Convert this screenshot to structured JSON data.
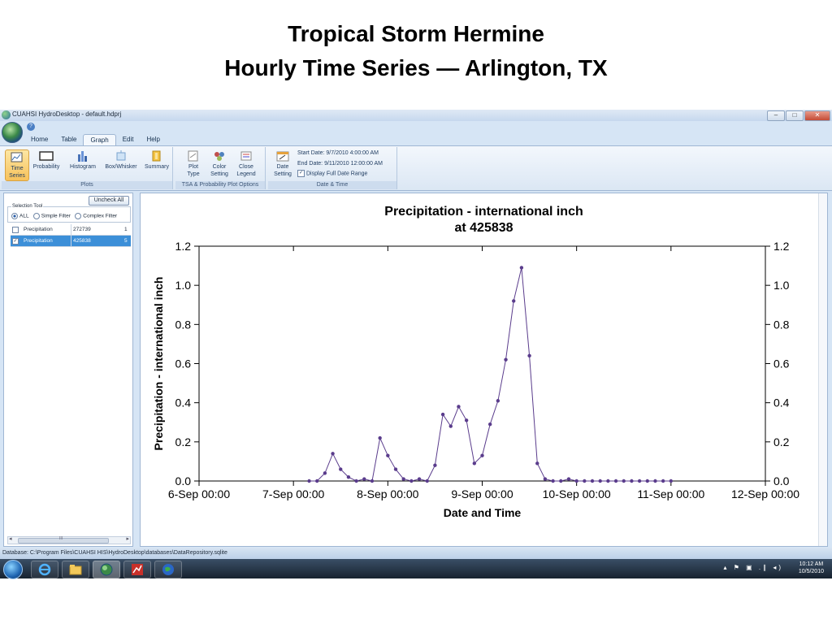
{
  "slide": {
    "title_line1": "Tropical Storm Hermine",
    "title_line2": "Hourly Time Series — Arlington, TX"
  },
  "window": {
    "title": "CUAHSI HydroDesktop - default.hdprj",
    "controls": {
      "minimize": "–",
      "maximize": "□",
      "close": "✕"
    }
  },
  "tabs": [
    "Home",
    "Table",
    "Graph",
    "Edit",
    "Help"
  ],
  "active_tab": "Graph",
  "ribbon": {
    "plots_group": {
      "label": "Plots",
      "buttons": [
        {
          "label_line1": "Time",
          "label_line2": "Series",
          "icon": "time-series-icon",
          "selected": true
        },
        {
          "label_line1": "Probability",
          "label_line2": "",
          "icon": "probability-icon"
        },
        {
          "label_line1": "Histogram",
          "label_line2": "",
          "icon": "histogram-icon"
        },
        {
          "label_line1": "Box/Whisker",
          "label_line2": "",
          "icon": "box-whisker-icon"
        },
        {
          "label_line1": "Summary",
          "label_line2": "",
          "icon": "summary-icon"
        }
      ]
    },
    "plot_options_group": {
      "label": "TSA & Probability Plot Options",
      "buttons": [
        {
          "label_line1": "Plot",
          "label_line2": "Type",
          "icon": "plot-type-icon"
        },
        {
          "label_line1": "Color",
          "label_line2": "Setting",
          "icon": "color-setting-icon"
        },
        {
          "label_line1": "Close",
          "label_line2": "Legend",
          "icon": "close-legend-icon"
        }
      ]
    },
    "date_group": {
      "label": "Date & Time",
      "button": {
        "label_line1": "Date",
        "label_line2": "Setting",
        "icon": "date-setting-icon"
      },
      "start_date": "Start Date: 9/7/2010 4:00:00 AM",
      "end_date": "End Date:  9/11/2010 12:00:00 AM",
      "full_range_label": "Display Full Date Range",
      "full_range_checked": "✓"
    }
  },
  "left_panel": {
    "uncheck_all": "Uncheck All",
    "selection_tool_label": "Selection Tool",
    "radio_all": "ALL",
    "radio_simple": "Simple Filter",
    "radio_complex": "Complex Filter",
    "rows": [
      {
        "check": "",
        "variable": "Precipitation",
        "site": "272739",
        "count": "1"
      },
      {
        "check": "✓",
        "variable": "Precipitation",
        "site": "425838",
        "count": "5"
      }
    ],
    "scroll_left": "◂",
    "scroll_right": "▸",
    "scroll_grip": "III"
  },
  "statusbar": {
    "text": "Database:  C:\\Program Files\\CUAHSI HIS\\HydroDesktop\\databases\\DataRepository.sqlite"
  },
  "taskbar": {
    "time": "10:12 AM",
    "date": "10/5/2010",
    "tray_icons": "▴ ⚑ ▣ .∥ ◂)"
  },
  "chart_data": {
    "type": "line",
    "title": "Precipitation - international inch",
    "subtitle": "at 425838",
    "xlabel": "Date and Time",
    "ylabel": "Precipitation - international inch",
    "xlim": [
      "2010-09-06 00:00",
      "2010-09-12 00:00"
    ],
    "ylim": [
      0,
      1.2
    ],
    "xticks": [
      "6-Sep 00:00",
      "7-Sep 00:00",
      "8-Sep 00:00",
      "9-Sep 00:00",
      "10-Sep 00:00",
      "11-Sep 00:00",
      "12-Sep 00:00"
    ],
    "yticks": [
      "0.0",
      "0.2",
      "0.4",
      "0.6",
      "0.8",
      "1.0",
      "1.2"
    ],
    "grid": false,
    "series": [
      {
        "color": "#5a3c8c",
        "x": [
          "2010-09-07 04:00",
          "2010-09-07 06:00",
          "2010-09-07 08:00",
          "2010-09-07 10:00",
          "2010-09-07 12:00",
          "2010-09-07 14:00",
          "2010-09-07 16:00",
          "2010-09-07 18:00",
          "2010-09-07 20:00",
          "2010-09-07 22:00",
          "2010-09-08 00:00",
          "2010-09-08 02:00",
          "2010-09-08 04:00",
          "2010-09-08 06:00",
          "2010-09-08 08:00",
          "2010-09-08 10:00",
          "2010-09-08 12:00",
          "2010-09-08 14:00",
          "2010-09-08 16:00",
          "2010-09-08 18:00",
          "2010-09-08 20:00",
          "2010-09-08 22:00",
          "2010-09-09 00:00",
          "2010-09-09 02:00",
          "2010-09-09 04:00",
          "2010-09-09 06:00",
          "2010-09-09 08:00",
          "2010-09-09 10:00",
          "2010-09-09 12:00",
          "2010-09-09 14:00",
          "2010-09-09 16:00",
          "2010-09-09 18:00",
          "2010-09-09 20:00",
          "2010-09-09 22:00",
          "2010-09-10 00:00",
          "2010-09-10 02:00",
          "2010-09-10 04:00",
          "2010-09-10 06:00",
          "2010-09-10 08:00",
          "2010-09-10 10:00",
          "2010-09-10 12:00",
          "2010-09-10 14:00",
          "2010-09-10 16:00",
          "2010-09-10 18:00",
          "2010-09-10 20:00",
          "2010-09-10 22:00",
          "2010-09-11 00:00"
        ],
        "y": [
          0,
          0,
          0.04,
          0.14,
          0.06,
          0.02,
          0,
          0.01,
          0,
          0.22,
          0.13,
          0.06,
          0.01,
          0,
          0.01,
          0,
          0.08,
          0.34,
          0.28,
          0.38,
          0.31,
          0.09,
          0.13,
          0.29,
          0.41,
          0.62,
          0.92,
          1.09,
          0.64,
          0.09,
          0.01,
          0,
          0,
          0.01,
          0,
          0,
          0,
          0,
          0,
          0,
          0,
          0,
          0,
          0,
          0,
          0,
          0
        ]
      }
    ]
  }
}
